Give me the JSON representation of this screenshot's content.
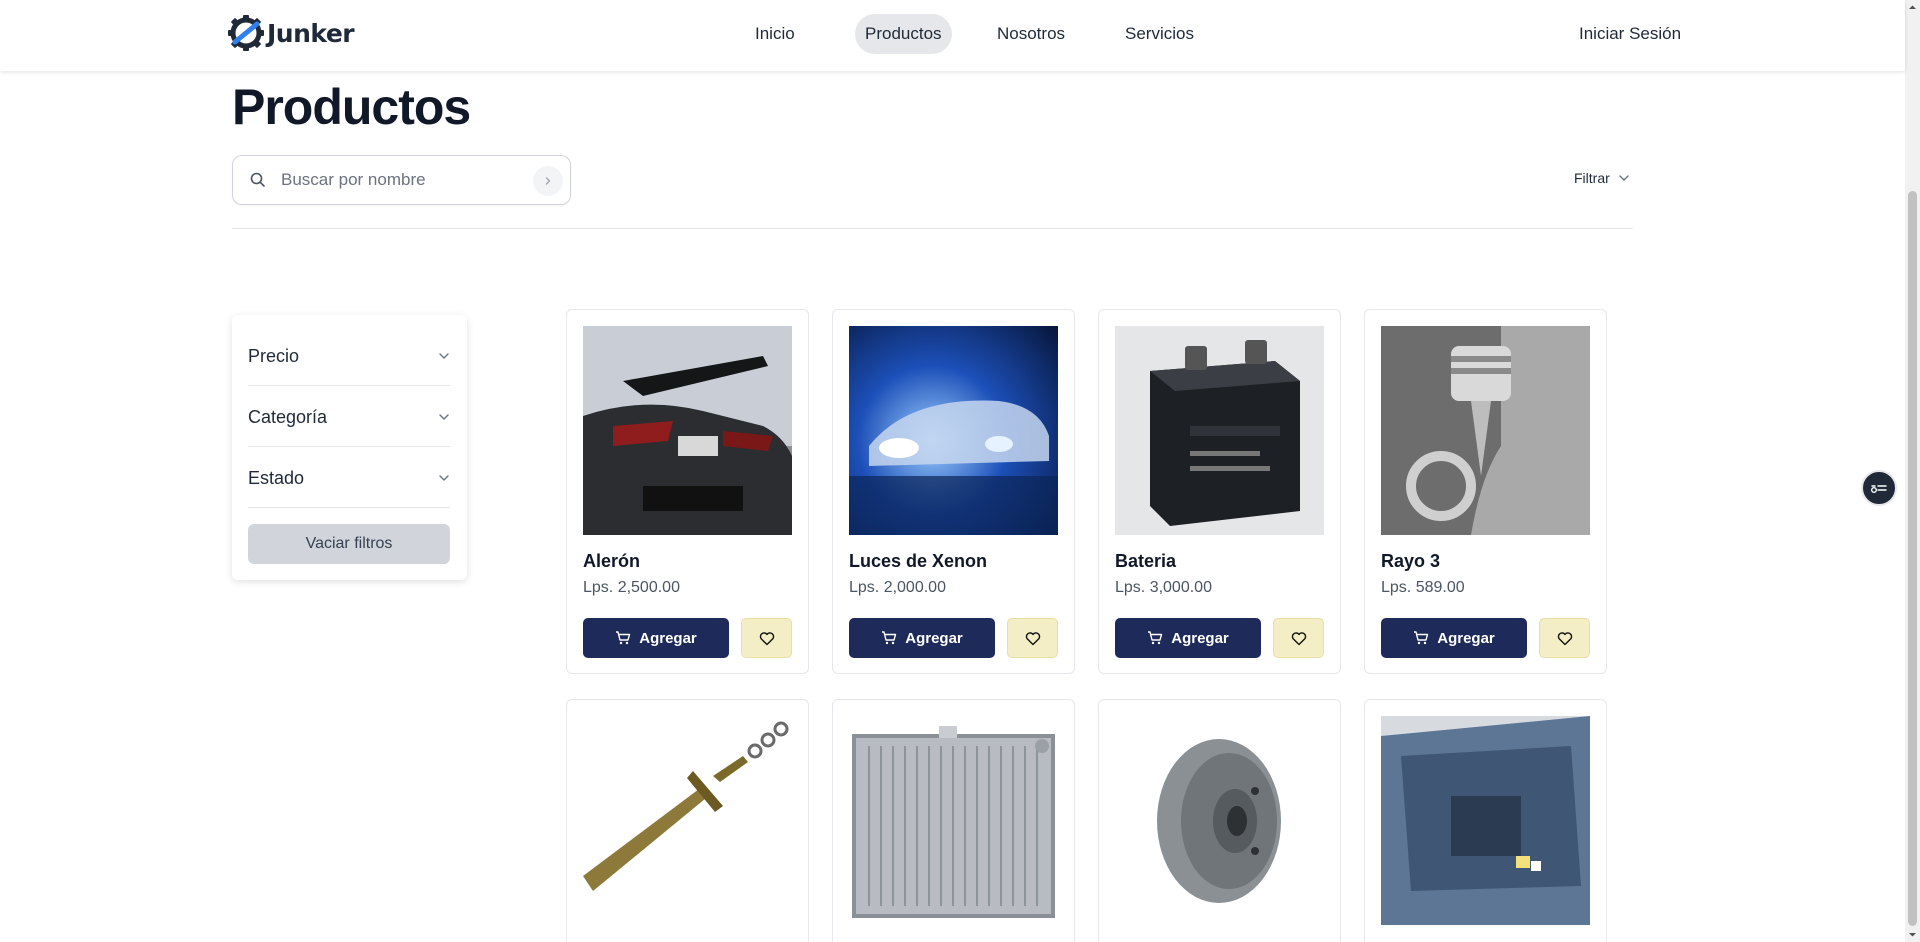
{
  "header": {
    "logo_text": "Junker",
    "nav": [
      {
        "label": "Inicio",
        "active": false
      },
      {
        "label": "Productos",
        "active": true
      },
      {
        "label": "Nosotros",
        "active": false
      },
      {
        "label": "Servicios",
        "active": false
      }
    ],
    "login_label": "Iniciar Sesión"
  },
  "page": {
    "title": "Productos",
    "search_placeholder": "Buscar por nombre",
    "filter_label": "Filtrar"
  },
  "filters": {
    "items": [
      {
        "label": "Precio"
      },
      {
        "label": "Categoría"
      },
      {
        "label": "Estado"
      }
    ],
    "clear_label": "Vaciar filtros"
  },
  "products": [
    {
      "name": "Alerón",
      "price": "Lps. 2,500.00",
      "add_label": "Agregar",
      "image": "car-spoiler-photo"
    },
    {
      "name": "Luces de Xenon",
      "price": "Lps. 2,000.00",
      "add_label": "Agregar",
      "image": "xenon-headlights-photo"
    },
    {
      "name": "Bateria",
      "price": "Lps. 3,000.00",
      "add_label": "Agregar",
      "image": "car-battery-photo"
    },
    {
      "name": "Rayo 3",
      "price": "Lps. 589.00",
      "add_label": "Agregar",
      "image": "engine-piston-photo"
    },
    {
      "name": "",
      "price": "",
      "add_label": "",
      "image": "sword-keychain-photo"
    },
    {
      "name": "",
      "price": "",
      "add_label": "",
      "image": "radiator-photo"
    },
    {
      "name": "",
      "price": "",
      "add_label": "",
      "image": "brake-drum-photo"
    },
    {
      "name": "",
      "price": "",
      "add_label": "",
      "image": "windshield-photo"
    }
  ],
  "colors": {
    "primary_button": "#1e2a5a",
    "favorite_button": "#f3eec5",
    "nav_active_bg": "#e5e7eb",
    "clear_button": "#d1d5db"
  }
}
